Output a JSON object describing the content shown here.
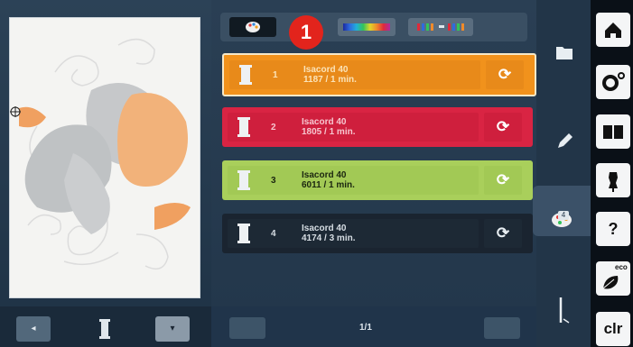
{
  "threads": [
    {
      "number": "1",
      "name": "Isacord 40",
      "stitch_info": "1187 / 1 min.",
      "color": "#f1921c"
    },
    {
      "number": "2",
      "name": "Isacord 40",
      "stitch_info": "1805 / 1 min.",
      "color": "#d92443"
    },
    {
      "number": "3",
      "name": "Isacord 40",
      "stitch_info": "6011 / 1 min.",
      "color": "#a9cf5b"
    },
    {
      "number": "4",
      "name": "Isacord 40",
      "stitch_info": "4174 / 3 min.",
      "color": "#1a2430"
    }
  ],
  "callout_badge": "1",
  "pager": {
    "page_indicator": "1/1"
  },
  "color_tab_count": "4",
  "function_buttons": {
    "clr_label": "clr",
    "eco_label": "eco",
    "help_label": "?"
  },
  "icons": [
    "home-icon",
    "settings-icon",
    "book-icon",
    "dress-form-icon",
    "help-icon",
    "eco-icon",
    "folder-icon",
    "pencil-icon",
    "palette-icon",
    "needle-icon",
    "refresh-icon",
    "spool-icon",
    "rainbow-bar-icon",
    "regroup-colors-icon"
  ],
  "accent_colors": {
    "badge": "#e2241c",
    "selected_border": "#f6e9c8"
  }
}
